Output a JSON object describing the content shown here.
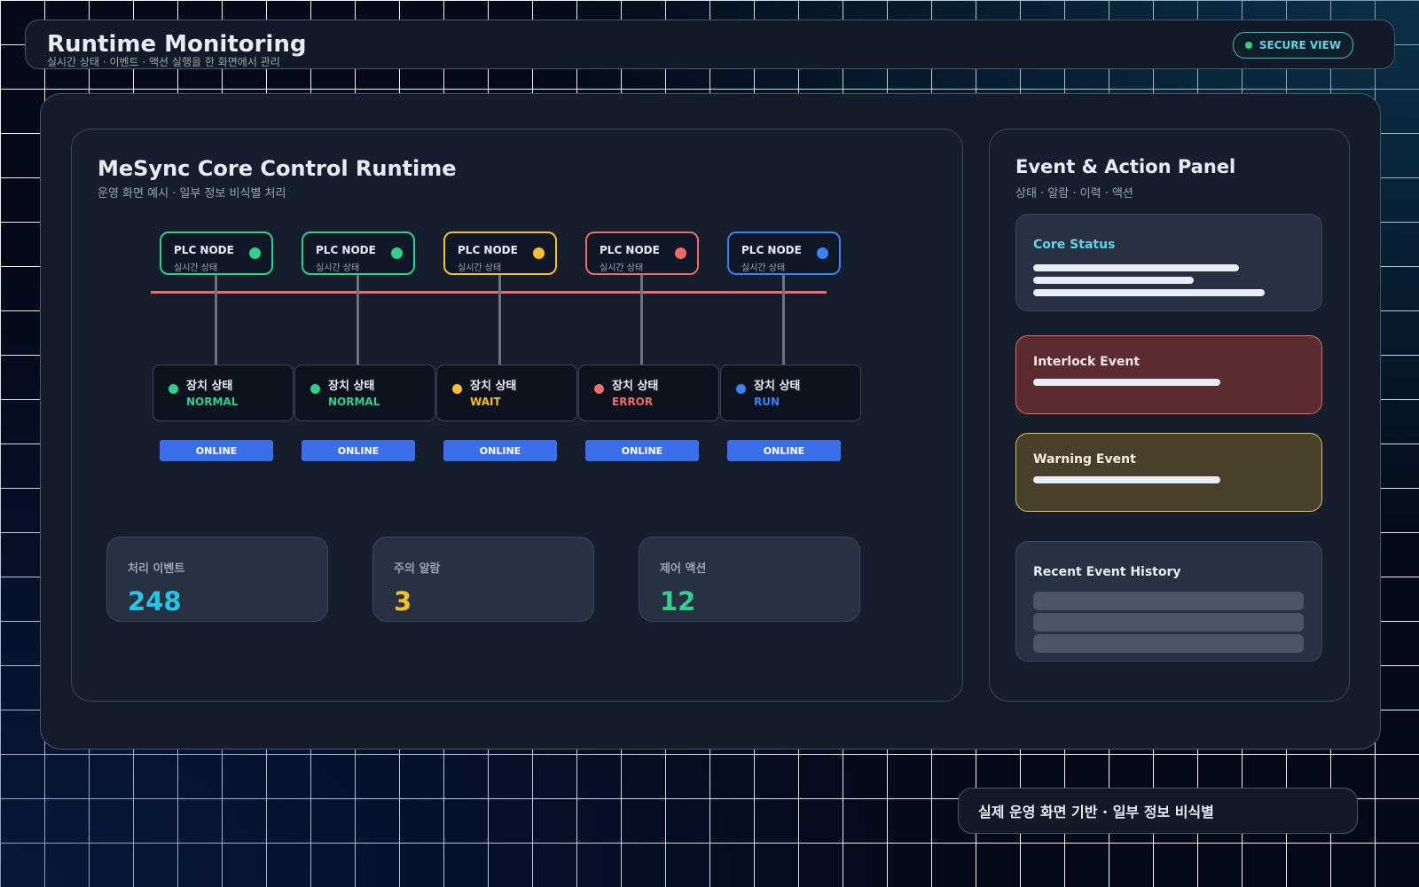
{
  "header": {
    "title": "Runtime Monitoring",
    "subtitle": "실시간 상태 · 이벤트 · 액션 실행을 한 화면에서 관리",
    "badge_label": "SECURE VIEW",
    "badge_dot_color": "#2ed38a"
  },
  "runtime": {
    "title": "MeSync Core Control Runtime",
    "subtitle": "운영 화면 예시 · 일부 정보 비식별 처리",
    "bus_color": "#f06a6a",
    "nodes": [
      {
        "label": "PLC NODE",
        "sub": "실시간 상태",
        "color": "#2ed38a"
      },
      {
        "label": "PLC NODE",
        "sub": "실시간 상태",
        "color": "#2ed38a"
      },
      {
        "label": "PLC NODE",
        "sub": "실시간 상태",
        "color": "#f5c02c"
      },
      {
        "label": "PLC NODE",
        "sub": "실시간 상태",
        "color": "#f06a6a"
      },
      {
        "label": "PLC NODE",
        "sub": "실시간 상태",
        "color": "#3b82f6"
      }
    ],
    "devices": [
      {
        "label": "장치 상태",
        "state": "NORMAL",
        "color": "#2ed38a"
      },
      {
        "label": "장치 상태",
        "state": "NORMAL",
        "color": "#2ed38a"
      },
      {
        "label": "장치 상태",
        "state": "WAIT",
        "color": "#f5c02c"
      },
      {
        "label": "장치 상태",
        "state": "ERROR",
        "color": "#f06a6a"
      },
      {
        "label": "장치 상태",
        "state": "RUN",
        "color": "#3b82f6"
      }
    ],
    "online_labels": [
      "ONLINE",
      "ONLINE",
      "ONLINE",
      "ONLINE",
      "ONLINE"
    ],
    "metrics": [
      {
        "label": "처리 이벤트",
        "value": "248",
        "color": "#22c7e8"
      },
      {
        "label": "주의 알람",
        "value": "3",
        "color": "#f5c02c"
      },
      {
        "label": "제어 액션",
        "value": "12",
        "color": "#2ed38a"
      }
    ]
  },
  "event_panel": {
    "title": "Event & Action Panel",
    "subtitle": "상태 · 알람 · 이력 · 액션",
    "core_status": {
      "title": "Core Status",
      "title_color": "#5fd4e6"
    },
    "interlock": {
      "title": "Interlock Event",
      "bg": "#5b2b30",
      "border": "#e26a6a"
    },
    "warning": {
      "title": "Warning Event",
      "bg": "#4a3f2a",
      "border": "#e6c24a"
    },
    "history": {
      "title": "Recent Event History"
    }
  },
  "footer": {
    "text": "실제 운영 화면 기반 · 일부 정보 비식별"
  }
}
